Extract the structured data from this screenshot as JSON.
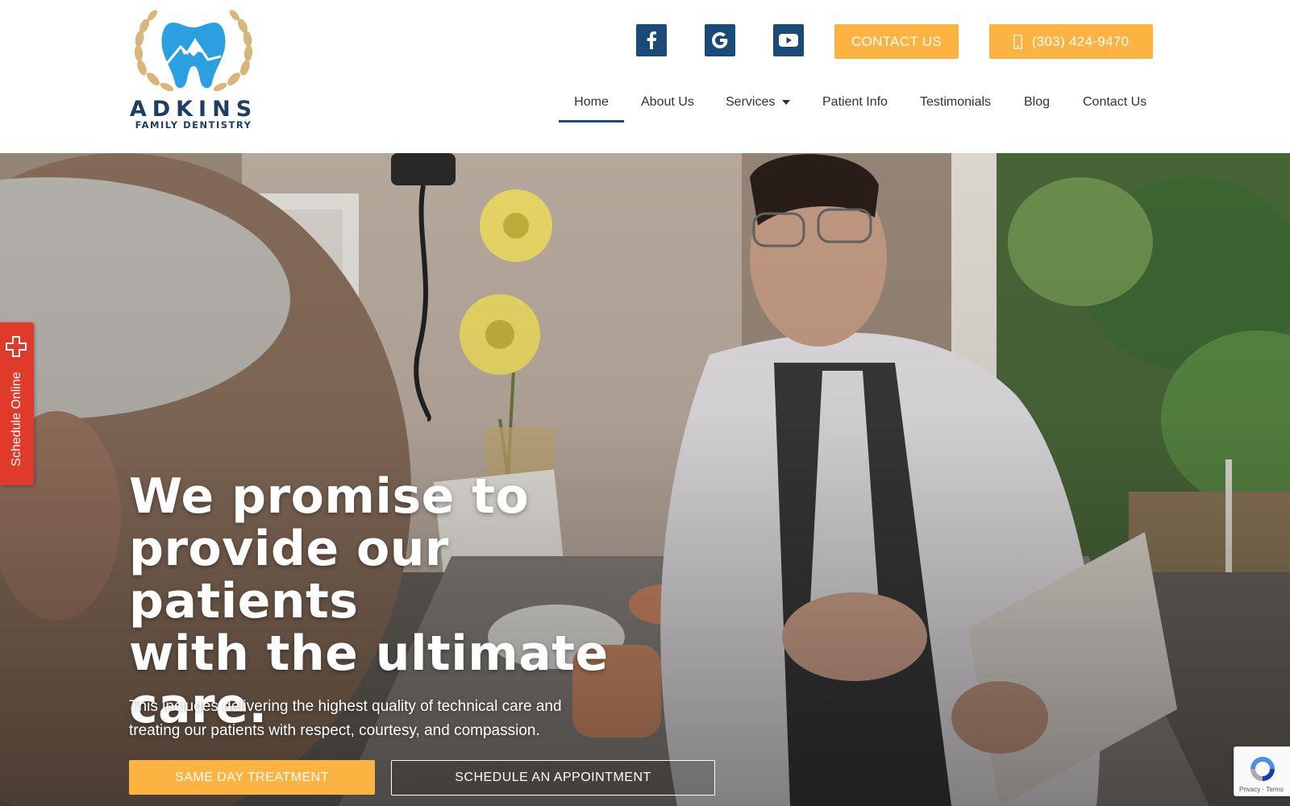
{
  "brand": {
    "name": "ADKINS",
    "tagline": "FAMILY DENTISTRY",
    "colors": {
      "navy": "#1a4a78",
      "orange": "#fdb341",
      "tooth_blue": "#2b9fe0",
      "laurel_gold": "#d8b57a",
      "schedule_red": "#e03a2a"
    }
  },
  "header": {
    "social": [
      {
        "name": "facebook",
        "icon": "facebook-icon"
      },
      {
        "name": "google",
        "icon": "google-icon"
      },
      {
        "name": "youtube",
        "icon": "youtube-icon"
      }
    ],
    "contact_button": "CONTACT US",
    "phone_button": "(303) 424-9470",
    "phone_icon": "mobile-phone-icon"
  },
  "nav": {
    "items": [
      {
        "label": "Home",
        "active": true
      },
      {
        "label": "About Us"
      },
      {
        "label": "Services",
        "has_dropdown": true
      },
      {
        "label": "Patient Info"
      },
      {
        "label": "Testimonials"
      },
      {
        "label": "Blog"
      },
      {
        "label": "Contact Us"
      }
    ]
  },
  "hero": {
    "headline_lines": [
      "We promise to",
      "provide our patients",
      "with the ultimate",
      "care."
    ],
    "subtext_lines": [
      "This includes delivering the highest quality of technical care and",
      "treating our patients with respect, courtesy, and compassion."
    ],
    "primary_cta": "SAME DAY TREATMENT",
    "secondary_cta": "SCHEDULE AN APPOINTMENT"
  },
  "schedule_tab": {
    "label": "Schedule Online",
    "icon": "medical-cross-icon"
  },
  "recaptcha": {
    "links": "Privacy - Terms",
    "icon": "recaptcha-icon"
  }
}
